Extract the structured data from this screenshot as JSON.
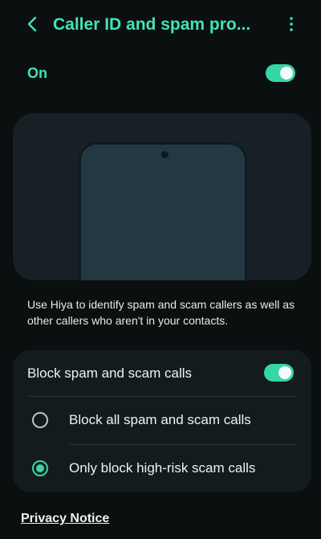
{
  "header": {
    "title": "Caller ID and spam pro...",
    "back_icon": "chevron-left-icon",
    "more_icon": "more-vertical-icon"
  },
  "master_switch": {
    "label": "On",
    "state": "on"
  },
  "illustration": {
    "icon": "phone-icon"
  },
  "description": "Use Hiya to identify spam and scam callers as well as other callers who aren't in your contacts.",
  "block": {
    "label": "Block spam and scam calls",
    "state": "on",
    "options": [
      {
        "label": "Block all spam and scam calls",
        "selected": false
      },
      {
        "label": "Only block high-risk scam calls",
        "selected": true
      }
    ]
  },
  "footer": {
    "privacy_link": "Privacy Notice"
  },
  "colors": {
    "accent": "#42e3b8",
    "toggle_track": "#36d6a6",
    "background": "#0a0f10",
    "card": "#141b1e"
  }
}
